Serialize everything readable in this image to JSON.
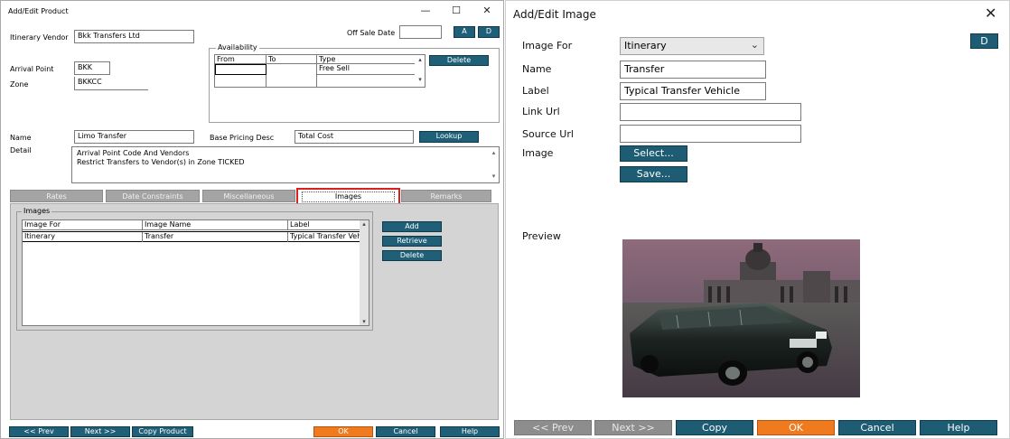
{
  "left_window": {
    "title": "Add/Edit Product",
    "controls": {
      "minimize": "—",
      "maximize": "☐",
      "close": "✕"
    },
    "fields": {
      "itinerary_vendor_label": "Itinerary Vendor",
      "itinerary_vendor_value": "Bkk Transfers Ltd",
      "off_sale_date_label": "Off Sale Date",
      "off_sale_date_value": "",
      "a_button": "A",
      "d_button": "D",
      "arrival_point_label": "Arrival Point",
      "arrival_point_value": "BKK",
      "zone_label": "Zone",
      "zone_value": "BKKCC",
      "name_label": "Name",
      "name_value": "Limo Transfer",
      "base_pricing_desc_label": "Base Pricing Desc",
      "base_pricing_desc_value": "Total Cost",
      "lookup_button": "Lookup",
      "detail_label": "Detail",
      "detail_line1": "Arrival Point Code And Vendors",
      "detail_line2": "Restrict Transfers to Vendor(s) in Zone TICKED"
    },
    "availability": {
      "legend": "Availability",
      "headers": [
        "From",
        "To",
        "Type"
      ],
      "row_type": "Free Sell",
      "delete_button": "Delete"
    },
    "tabs": [
      "Rates",
      "Date Constraints",
      "Miscellaneous",
      "Images",
      "Remarks"
    ],
    "images_panel": {
      "legend": "Images",
      "headers": [
        "Image For",
        "Image Name",
        "Label"
      ],
      "rows": [
        {
          "image_for": "Itinerary",
          "image_name": "Transfer",
          "label": "Typical Transfer Vehicl"
        }
      ],
      "add_button": "Add",
      "retrieve_button": "Retrieve",
      "delete_button": "Delete"
    },
    "bottom_buttons": {
      "prev": "<< Prev",
      "next": "Next >>",
      "copy_product": "Copy Product",
      "ok": "OK",
      "cancel": "Cancel",
      "help": "Help"
    }
  },
  "right_window": {
    "title": "Add/Edit Image",
    "close": "✕",
    "d_button": "D",
    "fields": {
      "image_for_label": "Image For",
      "image_for_value": "Itinerary",
      "name_label": "Name",
      "name_value": "Transfer",
      "label_label": "Label",
      "label_value": "Typical Transfer Vehicle",
      "link_url_label": "Link Url",
      "link_url_value": "",
      "source_url_label": "Source Url",
      "source_url_value": "",
      "image_label": "Image",
      "select_button": "Select...",
      "save_button": "Save..."
    },
    "preview_label": "Preview",
    "bottom_buttons": {
      "prev": "<< Prev",
      "next": "Next >>",
      "copy": "Copy",
      "ok": "OK",
      "cancel": "Cancel",
      "help": "Help"
    },
    "colors": {
      "accent": "#1d5c73",
      "ok": "#f07a1e",
      "disabled": "#8d8d8d"
    }
  }
}
